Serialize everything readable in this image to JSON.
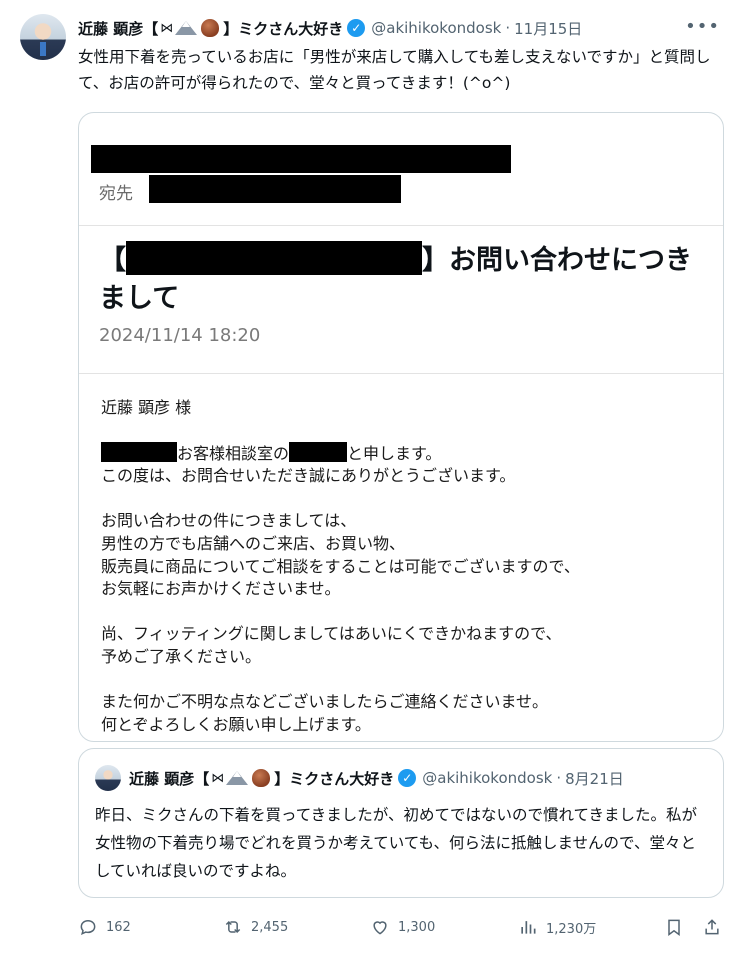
{
  "author": {
    "name": "近藤 顕彦【",
    "name_suffix": "】ミクさん大好き",
    "handle": "@akihikokondosk",
    "date": "11月15日"
  },
  "tweet_text": "女性用下着を売っているお店に「男性が来店して購入しても差し支えないですか」と質問して、お店の許可が得られたので、堂々と買ってきます！(^o^)",
  "email": {
    "to_label": "宛先",
    "title_open": "【",
    "title_close": "】お問い合わせにつきまして",
    "date": "2024/11/14 18:20",
    "greeting": "近藤 顕彦 様",
    "line1_mid": "お客様相談室の",
    "line1_end": "と申します。",
    "line2": "この度は、お問合せいただき誠にありがとうございます。",
    "para2": [
      "お問い合わせの件につきましては、",
      "男性の方でも店舗へのご来店、お買い物、",
      "販売員に商品についてご相談をすることは可能でございますので、",
      "お気軽にお声かけくださいませ。"
    ],
    "para3": [
      "尚、フィッティングに関しましてはあいにくできかねますので、",
      "予めご了承ください。"
    ],
    "para4": [
      "また何かご不明な点などございましたらご連絡くださいませ。",
      "何とぞよろしくお願い申し上げます。"
    ]
  },
  "quote": {
    "name": "近藤 顕彦【",
    "name_suffix": "】ミクさん大好き",
    "handle": "@akihikokondosk",
    "date": "8月21日",
    "text": "昨日、ミクさんの下着を買ってきましたが、初めてではないので慣れてきました。私が女性物の下着売り場でどれを買うか考えていても、何ら法に抵触しませんので、堂々としていれば良いのですよね。"
  },
  "actions": {
    "replies": "162",
    "reposts": "2,455",
    "likes": "1,300",
    "views": "1,230万"
  },
  "colors": {
    "accent": "#1d9bf0",
    "muted": "#536471",
    "border": "#cfd9de"
  }
}
